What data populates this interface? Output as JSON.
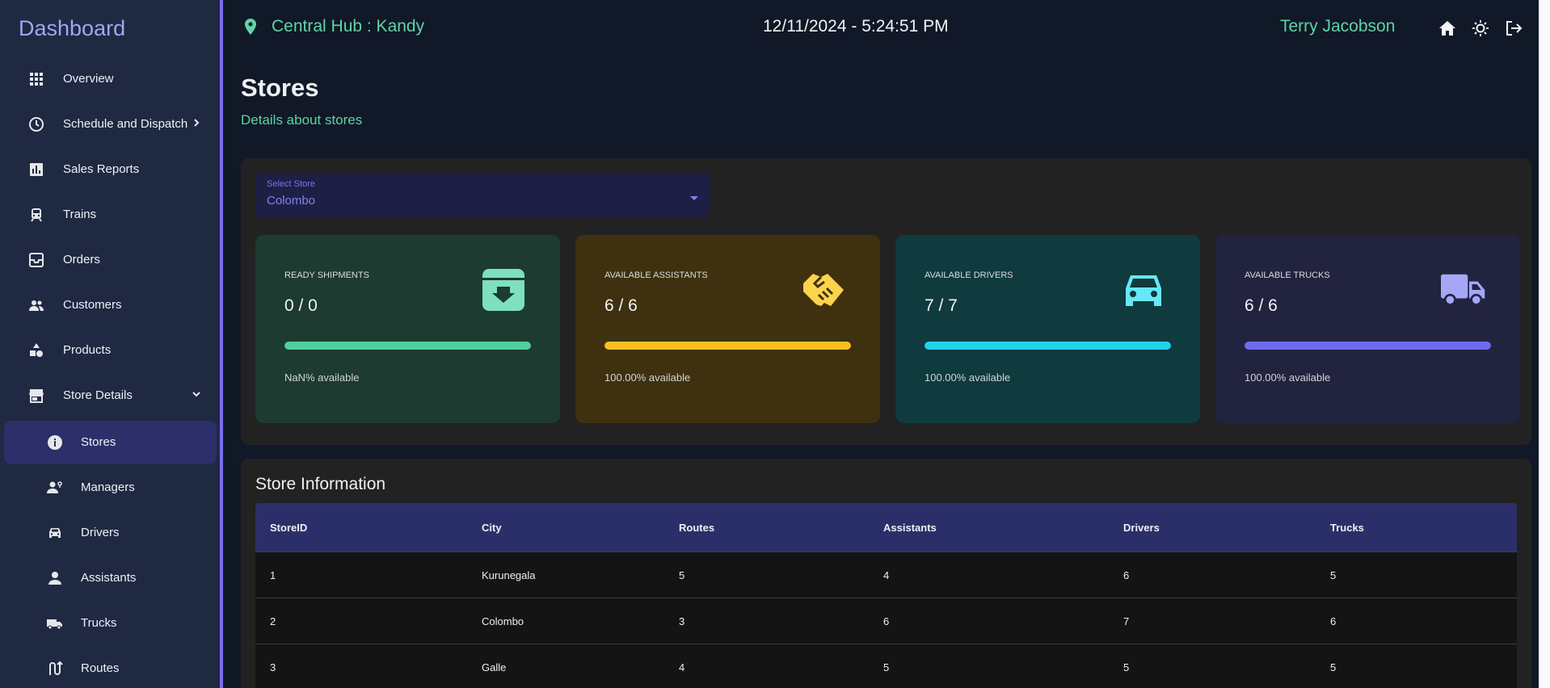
{
  "sidebar": {
    "title": "Dashboard",
    "items": [
      {
        "label": "Overview",
        "icon": "grid-icon"
      },
      {
        "label": "Schedule and Dispatch",
        "icon": "clock-icon"
      },
      {
        "label": "Sales Reports",
        "icon": "bar-chart-icon"
      },
      {
        "label": "Trains",
        "icon": "train-icon"
      },
      {
        "label": "Orders",
        "icon": "inbox-icon"
      },
      {
        "label": "Customers",
        "icon": "people-icon"
      },
      {
        "label": "Products",
        "icon": "shapes-icon"
      },
      {
        "label": "Store Details",
        "icon": "store-icon"
      },
      {
        "label": "Stores",
        "icon": "info-icon"
      },
      {
        "label": "Managers",
        "icon": "manager-icon"
      },
      {
        "label": "Drivers",
        "icon": "car-icon"
      },
      {
        "label": "Assistants",
        "icon": "person-icon"
      },
      {
        "label": "Trucks",
        "icon": "truck-icon"
      },
      {
        "label": "Routes",
        "icon": "route-icon"
      }
    ]
  },
  "header": {
    "hub": "Central Hub : Kandy",
    "datetime": "12/11/2024 - 5:24:51 PM",
    "user": "Terry Jacobson"
  },
  "page": {
    "title": "Stores",
    "subtitle": "Details about stores"
  },
  "select": {
    "label": "Select Store",
    "value": "Colombo"
  },
  "stats": [
    {
      "label": "READY SHIPMENTS",
      "value": "0 / 0",
      "progress": 1.0,
      "foot": "NaN% available",
      "color": "#4fcf9f",
      "bg": "#1d3b31",
      "icon": "archive-icon"
    },
    {
      "label": "AVAILABLE ASSISTANTS",
      "value": "6 / 6",
      "progress": 1.0,
      "foot": "100.00% available",
      "color": "#fbbf24",
      "bg": "#3f310f",
      "icon": "handshake-icon"
    },
    {
      "label": "AVAILABLE DRIVERS",
      "value": "7 / 7",
      "progress": 1.0,
      "foot": "100.00% available",
      "color": "#22d3ee",
      "bg": "#0f3a3e",
      "icon": "car-icon"
    },
    {
      "label": "AVAILABLE TRUCKS",
      "value": "6 / 6",
      "progress": 1.0,
      "foot": "100.00% available",
      "color": "#6d6bf0",
      "bg": "#22233f",
      "icon": "truck-icon"
    }
  ],
  "table": {
    "title": "Store Information",
    "columns": [
      "StoreID",
      "City",
      "Routes",
      "Assistants",
      "Drivers",
      "Trucks"
    ],
    "rows": [
      [
        "1",
        "Kurunegala",
        "5",
        "4",
        "6",
        "5"
      ],
      [
        "2",
        "Colombo",
        "3",
        "6",
        "7",
        "6"
      ],
      [
        "3",
        "Galle",
        "4",
        "5",
        "5",
        "5"
      ]
    ]
  }
}
